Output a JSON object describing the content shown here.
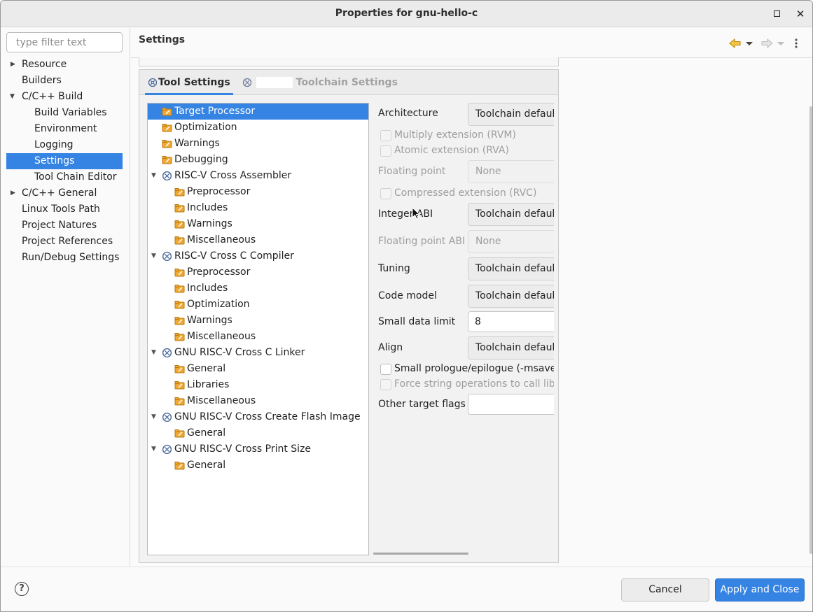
{
  "window": {
    "title": "Properties for gnu-hello-c"
  },
  "filter": {
    "placeholder": "type filter text",
    "value": ""
  },
  "nav": {
    "items": [
      {
        "label": "Resource",
        "expandable": true
      },
      {
        "label": "Builders"
      },
      {
        "label": "C/C++ Build",
        "expanded": true
      },
      {
        "label": "Build Variables"
      },
      {
        "label": "Environment"
      },
      {
        "label": "Logging"
      },
      {
        "label": "Settings",
        "selected": true
      },
      {
        "label": "Tool Chain Editor"
      },
      {
        "label": "C/C++ General",
        "expandable": true
      },
      {
        "label": "Linux Tools Path"
      },
      {
        "label": "Project Natures"
      },
      {
        "label": "Project References"
      },
      {
        "label": "Run/Debug Settings"
      }
    ]
  },
  "page": {
    "title": "Settings"
  },
  "tabs": [
    {
      "label": "Tool Settings",
      "active": true
    },
    {
      "label": "Toolchain Settings",
      "active": false
    }
  ],
  "tree": [
    {
      "label": "Target Processor",
      "selected": true
    },
    {
      "label": "Optimization"
    },
    {
      "label": "Warnings"
    },
    {
      "label": "Debugging"
    },
    {
      "label": "RISC-V Cross Assembler"
    },
    {
      "label": "Preprocessor"
    },
    {
      "label": "Includes"
    },
    {
      "label": "Warnings"
    },
    {
      "label": "Miscellaneous"
    },
    {
      "label": "RISC-V Cross C Compiler"
    },
    {
      "label": "Preprocessor"
    },
    {
      "label": "Includes"
    },
    {
      "label": "Optimization"
    },
    {
      "label": "Warnings"
    },
    {
      "label": "Miscellaneous"
    },
    {
      "label": "GNU RISC-V Cross C Linker"
    },
    {
      "label": "General"
    },
    {
      "label": "Libraries"
    },
    {
      "label": "Miscellaneous"
    },
    {
      "label": "GNU RISC-V Cross Create Flash Image"
    },
    {
      "label": "General"
    },
    {
      "label": "GNU RISC-V Cross Print Size"
    },
    {
      "label": "General"
    }
  ],
  "options": {
    "architecture": {
      "label": "Architecture",
      "value": "Toolchain default"
    },
    "multiply": {
      "label": "Multiply extension (RVM)"
    },
    "atomic": {
      "label": "Atomic extension (RVA)"
    },
    "floating_point": {
      "label": "Floating point",
      "value": "None"
    },
    "compressed": {
      "label": "Compressed extension (RVC)"
    },
    "integer_abi": {
      "label": "Integer ABI",
      "value": "Toolchain default"
    },
    "floating_point_abi": {
      "label": "Floating point ABI",
      "value": "None"
    },
    "tuning": {
      "label": "Tuning",
      "value": "Toolchain default"
    },
    "code_model": {
      "label": "Code model",
      "value": "Toolchain default"
    },
    "small_data_limit": {
      "label": "Small data limit",
      "value": "8"
    },
    "align": {
      "label": "Align",
      "value": "Toolchain default"
    },
    "small_prologue": {
      "label": "Small prologue/epilogue (-msave-restore)"
    },
    "force_string": {
      "label": "Force string operations to call library"
    },
    "other_flags": {
      "label": "Other target flags",
      "value": ""
    }
  },
  "buttons": {
    "cancel": "Cancel",
    "apply": "Apply and Close"
  },
  "colors": {
    "accent": "#3584e4",
    "folder": "#f0a830"
  }
}
